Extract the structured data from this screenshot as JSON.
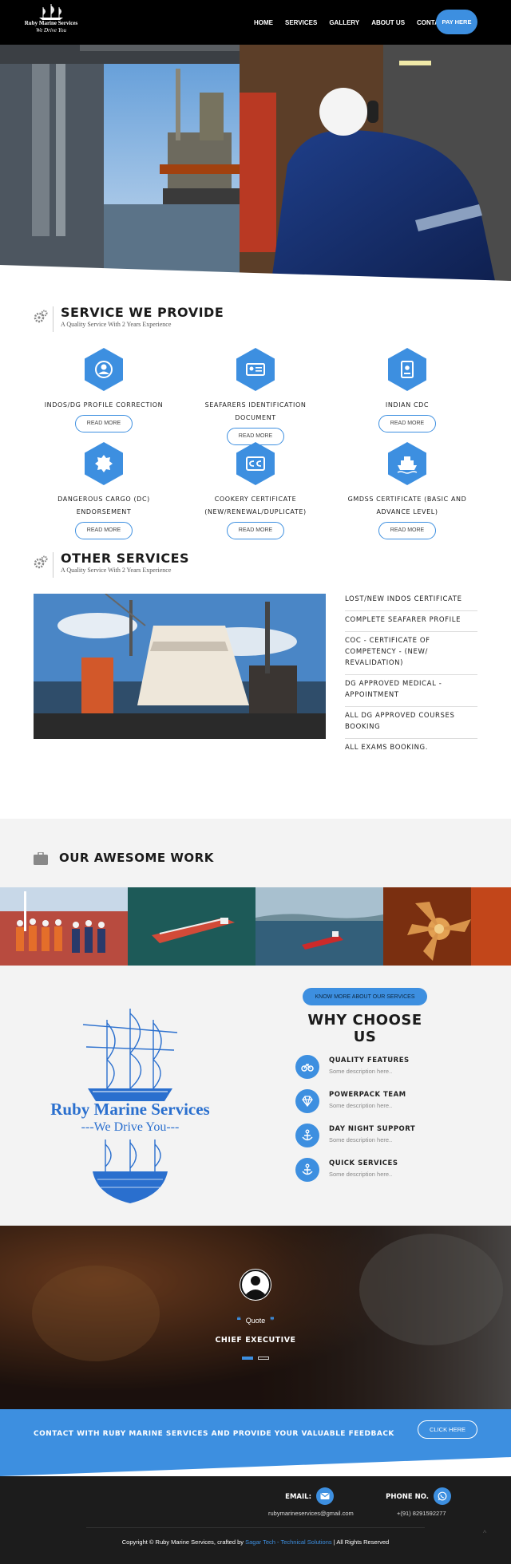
{
  "header": {
    "logo_line1": "Ruby Marine Services",
    "logo_line2": "We Drive You",
    "nav": [
      "HOME",
      "SERVICES",
      "GALLERY",
      "ABOUT US",
      "CONTACT"
    ],
    "pay_label": "PAY HERE"
  },
  "services_section": {
    "title": "SERVICE WE PROVIDE",
    "subtitle": "A Quality Service With 2 Years Experience",
    "items": [
      {
        "name": "INDOS/DG PROFILE CORRECTION",
        "icon": "user-icon",
        "button": "READ MORE"
      },
      {
        "name": "SEAFARERS IDENTIFICATION DOCUMENT",
        "icon": "id-card-icon",
        "button": "READ MORE"
      },
      {
        "name": "INDIAN CDC",
        "icon": "passport-icon",
        "button": "READ MORE"
      },
      {
        "name": "DANGEROUS CARGO (DC) ENDORSEMENT",
        "icon": "badge-icon",
        "button": "READ MORE"
      },
      {
        "name": "COOKERY CERTIFICATE (NEW/RENEWAL/DUPLICATE)",
        "icon": "cc-icon",
        "button": "READ MORE"
      },
      {
        "name": "GMDSS CERTIFICATE (BASIC AND ADVANCE LEVEL)",
        "icon": "ship-icon",
        "button": "READ MORE"
      }
    ]
  },
  "other_section": {
    "title": "OTHER SERVICES",
    "subtitle": "A Quality Service With 2 Years Experience",
    "list": [
      "LOST/NEW INDOS CERTIFICATE",
      "COMPLETE SEAFARER PROFILE",
      "COC - CERTIFICATE OF COMPETENCY - (NEW/ REVALIDATION)",
      "DG APPROVED MEDICAL - APPOINTMENT",
      "ALL DG APPROVED COURSES BOOKING",
      "ALL EXAMS BOOKING."
    ]
  },
  "work_section": {
    "title": "OUR AWESOME WORK",
    "know_more": "KNOW MORE ABOUT OUR SERVICES",
    "why_title": "WHY CHOOSE US",
    "brand_title": "Ruby Marine Services",
    "brand_tagline": "---We Drive You---",
    "features": [
      {
        "title": "QUALITY FEATURES",
        "desc": "Some description here..",
        "icon": "bicycle-icon"
      },
      {
        "title": "POWERPACK TEAM",
        "desc": "Some description here..",
        "icon": "diamond-icon"
      },
      {
        "title": "DAY NIGHT SUPPORT",
        "desc": "Some description here..",
        "icon": "anchor-icon"
      },
      {
        "title": "QUICK SERVICES",
        "desc": "Some description here..",
        "icon": "anchor-icon"
      }
    ]
  },
  "testimonial": {
    "quote": "Quote",
    "role": "CHIEF EXECUTIVE"
  },
  "contact": {
    "text": "CONTACT WITH RUBY MARINE SERVICES AND PROVIDE YOUR VALUABLE FEEDBACK",
    "button": "CLICK HERE"
  },
  "footer": {
    "email_label": "EMAIL:",
    "email": "rubymarineservices@gmail.com",
    "phone_label": "PHONE NO.",
    "phone": "+(91) 8291592277",
    "copy_prefix": "Copyright © Ruby Marine Services, crafted by",
    "copy_link": "Sagar Tech - Technical Solutions",
    "copy_suffix": "| All Rights Reserved",
    "to_top": "^"
  },
  "colors": {
    "accent": "#3d8fe0",
    "header_bg": "#000000",
    "footer_bg": "#1c1c1c",
    "section_gray": "#f3f3f3"
  }
}
